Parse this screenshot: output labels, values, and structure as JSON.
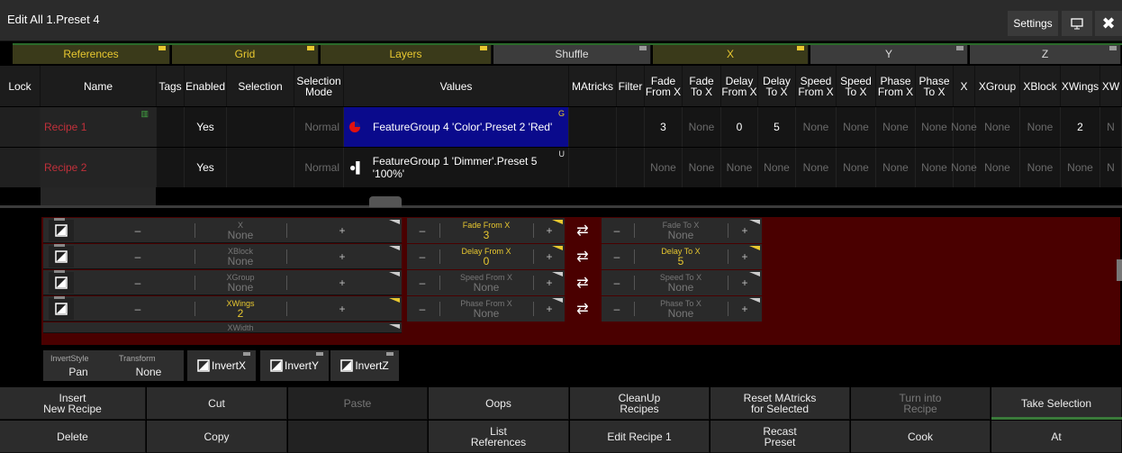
{
  "window": {
    "title": "Edit All 1.Preset 4",
    "settings_label": "Settings"
  },
  "tabs": [
    {
      "label": "References",
      "style": "yellow"
    },
    {
      "label": "Grid",
      "style": "yellow"
    },
    {
      "label": "Layers",
      "style": "yellow"
    },
    {
      "label": "Shuffle",
      "style": "white"
    },
    {
      "label": "X",
      "style": "yellow"
    },
    {
      "label": "Y",
      "style": "white"
    },
    {
      "label": "Z",
      "style": "white"
    }
  ],
  "grid": {
    "headers": [
      "Lock",
      "Name",
      "Tags",
      "Enabled",
      "Selection",
      "Selection\nMode",
      "Values",
      "MAtricks",
      "Filter",
      "Fade\nFrom X",
      "Fade\nTo X",
      "Delay\nFrom X",
      "Delay\nTo X",
      "Speed\nFrom X",
      "Speed\nTo X",
      "Phase\nFrom X",
      "Phase\nTo X",
      "X",
      "XGroup",
      "XBlock",
      "XWings",
      "XW"
    ],
    "rows": [
      {
        "name": "Recipe 1",
        "enabled": "Yes",
        "mode": "Normal",
        "value": "FeatureGroup 4 'Color'.Preset 2 'Red'",
        "value_badge": "G",
        "fade_from": "3",
        "fade_to": "None",
        "delay_from": "0",
        "delay_to": "5",
        "speed_from": "None",
        "speed_to": "None",
        "phase_from": "None",
        "phase_to": "None",
        "x": "None",
        "xgroup": "None",
        "xblock": "None",
        "xwings": "2",
        "xw": "N"
      },
      {
        "name": "Recipe 2",
        "enabled": "Yes",
        "mode": "Normal",
        "value": "FeatureGroup 1 'Dimmer'.Preset 5 '100%'",
        "value_badge": "U",
        "fade_from": "None",
        "fade_to": "None",
        "delay_from": "None",
        "delay_to": "None",
        "speed_from": "None",
        "speed_to": "None",
        "phase_from": "None",
        "phase_to": "None",
        "x": "None",
        "xgroup": "None",
        "xblock": "None",
        "xwings": "None",
        "xw": "N"
      }
    ]
  },
  "faders": {
    "left": [
      {
        "label": "X",
        "value": "None",
        "active": false
      },
      {
        "label": "XBlock",
        "value": "None",
        "active": false
      },
      {
        "label": "XGroup",
        "value": "None",
        "active": false
      },
      {
        "label": "XWings",
        "value": "2",
        "active": true
      },
      {
        "label": "XWidth",
        "value": "",
        "active": false
      }
    ],
    "pairs": [
      {
        "from_label": "Fade From X",
        "from_value": "3",
        "from_active": true,
        "to_label": "Fade To X",
        "to_value": "None",
        "to_active": false
      },
      {
        "from_label": "Delay From X",
        "from_value": "0",
        "from_active": true,
        "to_label": "Delay To X",
        "to_value": "5",
        "to_active": true
      },
      {
        "from_label": "Speed From X",
        "from_value": "None",
        "from_active": false,
        "to_label": "Speed To X",
        "to_value": "None",
        "to_active": false
      },
      {
        "from_label": "Phase From X",
        "from_value": "None",
        "from_active": false,
        "to_label": "Phase To X",
        "to_value": "None",
        "to_active": false
      }
    ],
    "minus": "–",
    "plus": "+"
  },
  "invert": {
    "style_label": "InvertStyle",
    "style_value": "Pan",
    "transform_label": "Transform",
    "transform_value": "None",
    "x": "InvertX",
    "y": "InvertY",
    "z": "InvertZ"
  },
  "buttons": {
    "row1": [
      "Insert\nNew Recipe",
      "Cut",
      "Paste",
      "Oops",
      "CleanUp\nRecipes",
      "Reset MAtricks\nfor Selected",
      "Turn into\nRecipe",
      "Take Selection"
    ],
    "row2": [
      "Delete",
      "Copy",
      "",
      "List\nReferences",
      "Edit Recipe 1",
      "Recast\nPreset",
      "Cook",
      "At"
    ]
  },
  "colors": {
    "accent": "#e8c830",
    "recipe_name": "#c0303a",
    "selected_value": "#0a0a8c",
    "fader_area": "#4a0000"
  }
}
